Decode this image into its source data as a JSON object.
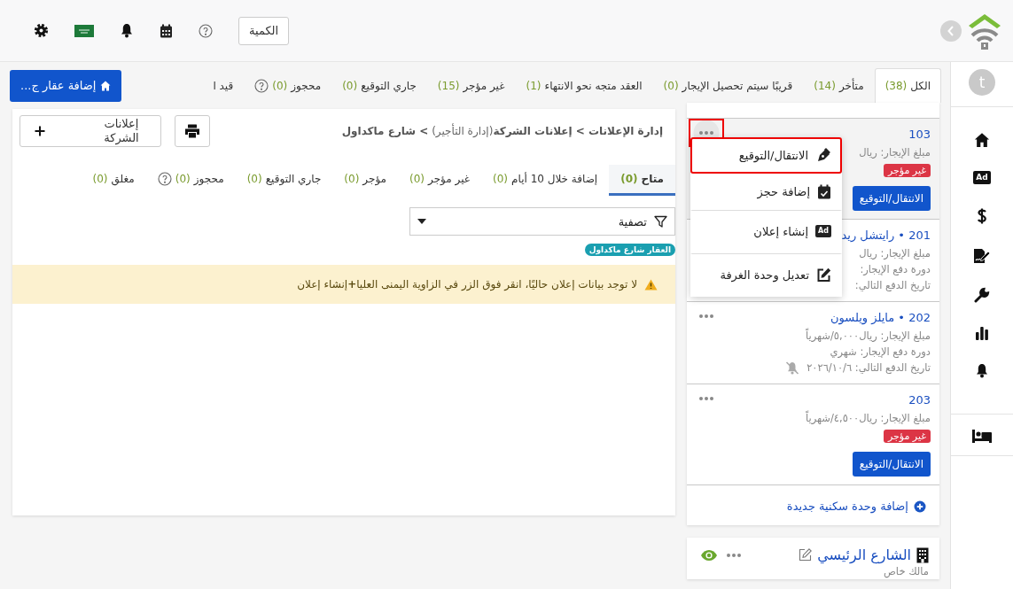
{
  "header": {
    "quantity_button": "الكمية"
  },
  "sidebar": {
    "avatar": "t",
    "ad_badge": "Ad"
  },
  "status_tabs": [
    {
      "label": "الكل",
      "count": "(38)",
      "selected": true,
      "help": false
    },
    {
      "label": "متأخر",
      "count": "(14)",
      "selected": false,
      "help": false
    },
    {
      "label": "قريبًا سيتم تحصيل الإيجار",
      "count": "(0)",
      "selected": false,
      "help": false
    },
    {
      "label": "العقد متجه نحو الانتهاء",
      "count": "(1)",
      "selected": false,
      "help": false
    },
    {
      "label": "غير مؤجر",
      "count": "(15)",
      "selected": false,
      "help": false
    },
    {
      "label": "جاري التوقيع",
      "count": "(0)",
      "selected": false,
      "help": false
    },
    {
      "label": "محجوز",
      "count": "(0)",
      "selected": false,
      "help": true
    },
    {
      "label": "قيد ا",
      "selected": false,
      "help": false
    }
  ],
  "add_property_button": "إضافة عقار ج...",
  "units": [
    {
      "title": "103",
      "lines": [
        "مبلغ الإيجار: ريال"
      ],
      "status": "غير مؤجر",
      "action": "الانتقال/التوقيع",
      "selected": true,
      "highlighted": true,
      "muted": false
    },
    {
      "title": "201 • رايتشل ريد",
      "lines": [
        "مبلغ الإيجار: ريال",
        "دورة دفع الإيجار:",
        "تاريخ الدفع التالي:"
      ],
      "selected": false,
      "muted": false
    },
    {
      "title": "202 • مايلز ويلسون",
      "lines": [
        "مبلغ الإيجار: ريال٥,٠٠٠/شهرياً",
        "دورة دفع الإيجار: شهري",
        "تاريخ الدفع التالي: ٢٠٢٦/١٠/٦"
      ],
      "selected": false,
      "highlighted": false,
      "muted": true
    },
    {
      "title": "203",
      "lines": [
        "مبلغ الإيجار: ريال٤,٥٠٠/شهرياً"
      ],
      "status": "غير مؤجر",
      "action": "الانتقال/التوقيع",
      "selected": false,
      "highlighted": false,
      "muted": false
    }
  ],
  "unit_menu": {
    "items": [
      {
        "kind": "pen",
        "label": "الانتقال/التوقيع",
        "highlighted": true
      },
      {
        "kind": "calendar",
        "label": "إضافة حجز",
        "highlighted": false
      },
      {
        "kind": "ad",
        "label": "إنشاء إعلان",
        "icon_text": "Ad",
        "highlighted": false
      },
      {
        "kind": "edit",
        "label": "تعديل وحدة الغرفة",
        "highlighted": false
      }
    ]
  },
  "add_unit_link": "إضافة وحدة سكنية جديدة",
  "property": {
    "name": "الشارع الرئيسي",
    "owner": "مالك خاص",
    "visible": true
  },
  "ads_panel": {
    "breadcrumb": "**إدارة الإعلانات > إعلانات الشركة**(إدارة التأجير) **> شارع ماكداول**",
    "company_ads_button": "إعلانات الشركة",
    "tabs": [
      {
        "label": "متاح",
        "count": "(0)",
        "selected": true,
        "help": false
      },
      {
        "label": "إضافة خلال 10 أيام",
        "count": "(0)",
        "selected": false,
        "help": false
      },
      {
        "label": "غير مؤجر",
        "count": "(0)",
        "selected": false,
        "help": false
      },
      {
        "label": "مؤجر",
        "count": "(0)",
        "selected": false,
        "help": false
      },
      {
        "label": "جاري التوقيع",
        "count": "(0)",
        "selected": false,
        "help": false
      },
      {
        "label": "محجوز",
        "count": "(0)",
        "selected": false,
        "help": true
      },
      {
        "label": "مغلق",
        "count": "(0)",
        "selected": false,
        "help": false
      }
    ],
    "filter": {
      "placeholder": "تصفية"
    },
    "tag": "العقار شارع ماكداول",
    "alert": "لا توجد بيانات إعلان حاليًا، انقر فوق الزر في الزاوية اليمنى العليا**+**إنشاء إعلان"
  }
}
